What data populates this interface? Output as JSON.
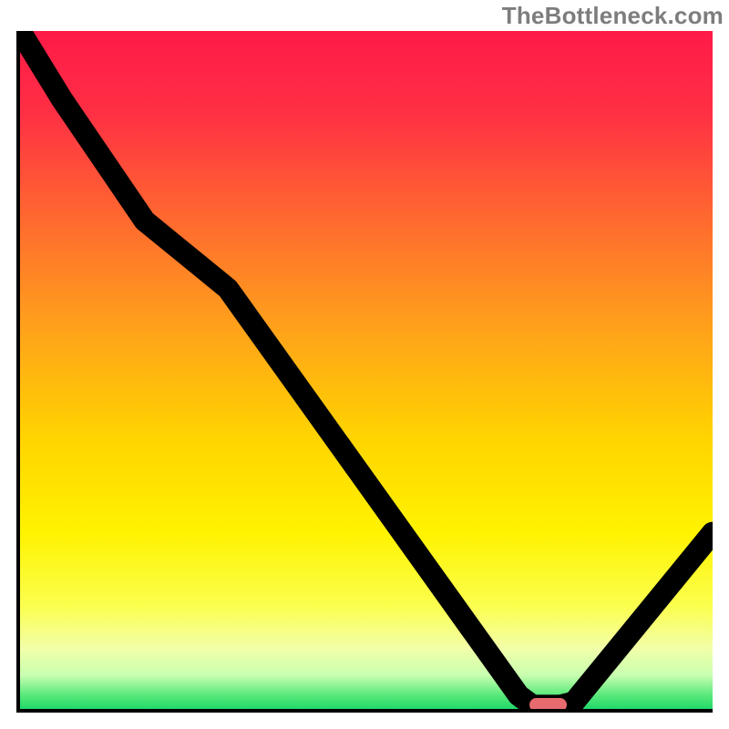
{
  "watermark": "TheBottleneck.com",
  "colors": {
    "gradient_stops": [
      {
        "pct": 0,
        "color": "#ff1a49"
      },
      {
        "pct": 12,
        "color": "#ff2f44"
      },
      {
        "pct": 28,
        "color": "#ff6a2f"
      },
      {
        "pct": 44,
        "color": "#ffa21a"
      },
      {
        "pct": 60,
        "color": "#ffd400"
      },
      {
        "pct": 74,
        "color": "#fff300"
      },
      {
        "pct": 85,
        "color": "#fbff50"
      },
      {
        "pct": 91,
        "color": "#f2ffa8"
      },
      {
        "pct": 95,
        "color": "#c9ffb0"
      },
      {
        "pct": 98,
        "color": "#58e87a"
      },
      {
        "pct": 100,
        "color": "#21d96a"
      }
    ],
    "marker": "#e66a6e",
    "axis": "#000000"
  },
  "chart_data": {
    "type": "line",
    "title": "",
    "xlabel": "",
    "ylabel": "",
    "x": [
      0.0,
      0.06,
      0.18,
      0.24,
      0.3,
      0.72,
      0.74,
      0.78,
      0.8,
      1.0
    ],
    "values": [
      1.0,
      0.9,
      0.72,
      0.67,
      0.62,
      0.02,
      0.005,
      0.005,
      0.01,
      0.26
    ],
    "xlim": [
      0,
      1
    ],
    "ylim": [
      0,
      1
    ],
    "marker": {
      "x_start": 0.735,
      "x_end": 0.79,
      "y": 0.005
    }
  }
}
